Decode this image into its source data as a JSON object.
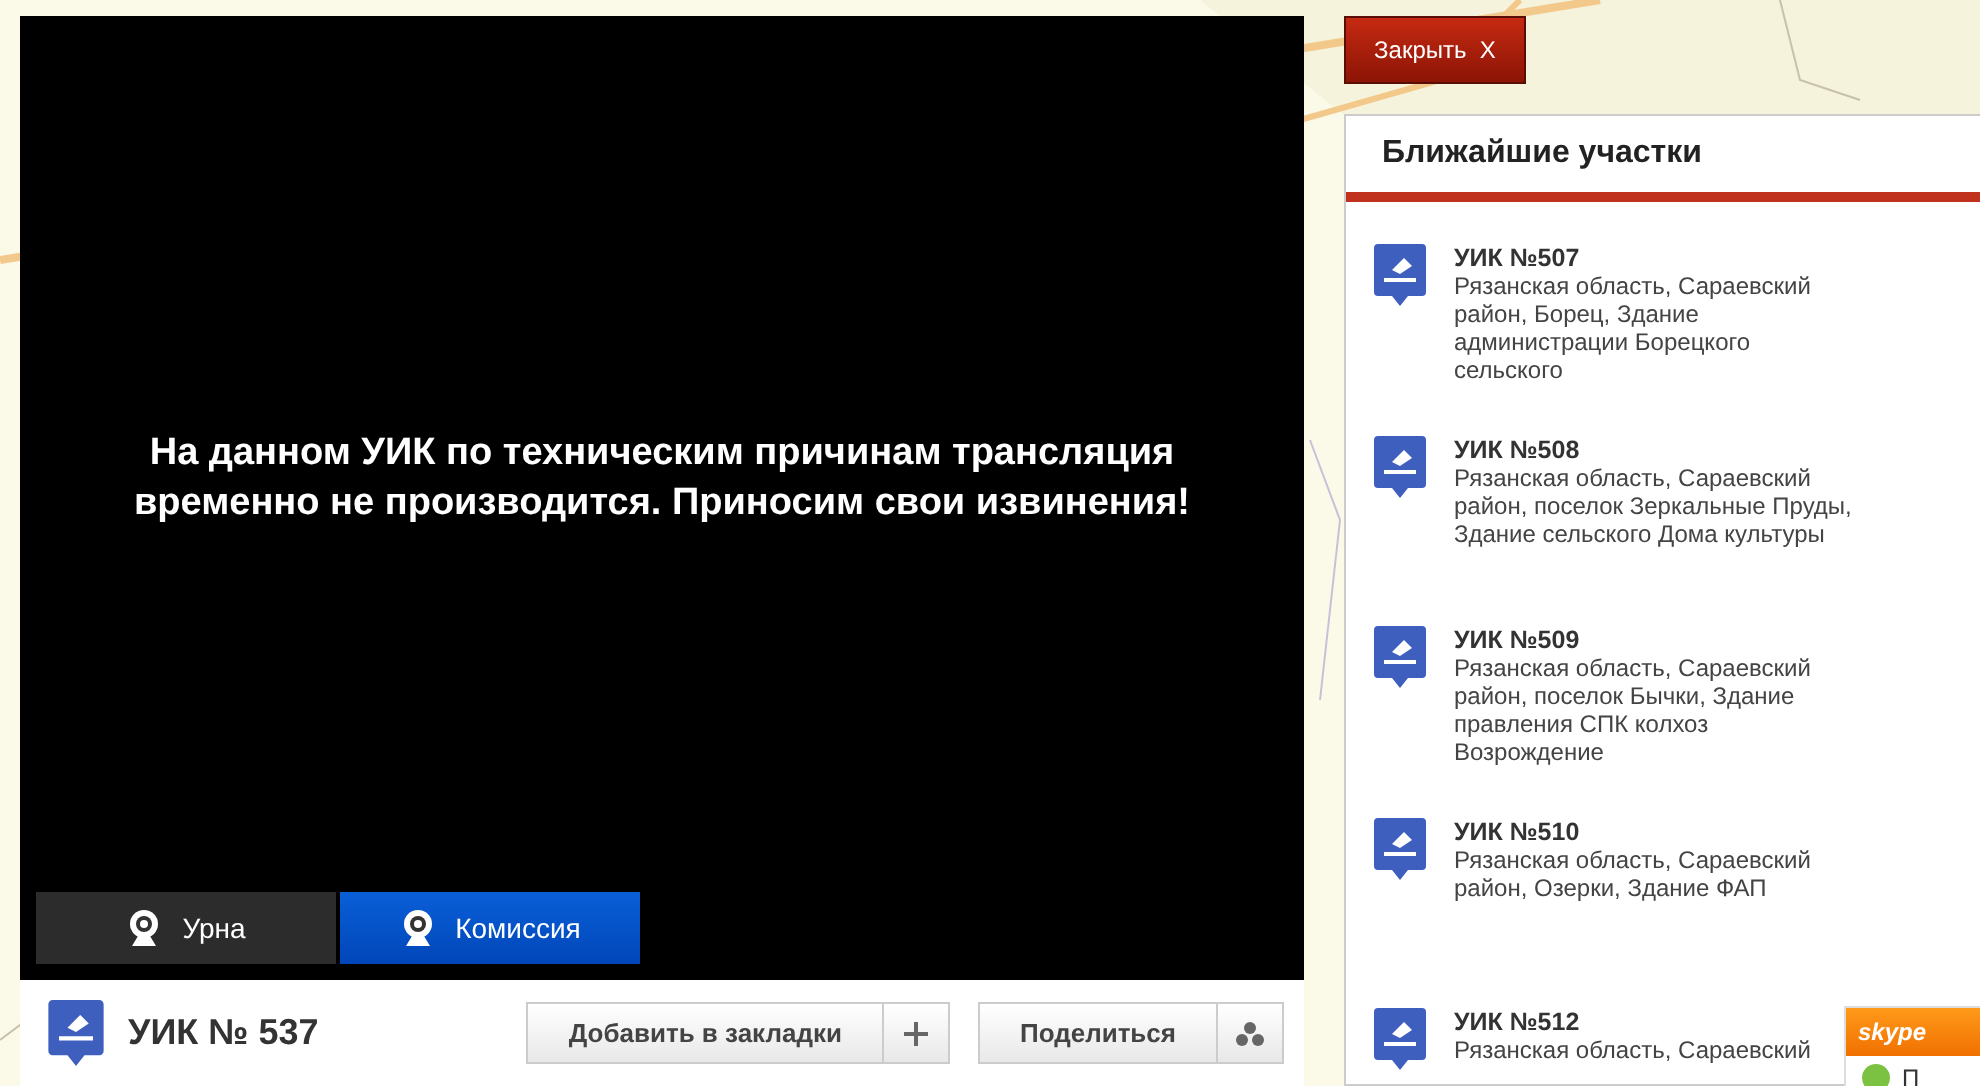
{
  "video": {
    "message": "На данном УИК по техническим причинам трансляция временно не производится. Приносим свои извинения!",
    "cameras": [
      {
        "label": "Урна",
        "selected": false
      },
      {
        "label": "Комиссия",
        "selected": true
      }
    ]
  },
  "station": {
    "title": "УИК № 537",
    "buttons": [
      {
        "label": "Добавить в закладки",
        "kind": "plus"
      },
      {
        "label": "Поделиться",
        "kind": "share"
      }
    ]
  },
  "close_button": "Закрыть  X",
  "nearby": {
    "title": "Ближайшие участки",
    "items": [
      {
        "name": "УИК №507",
        "address": "Рязанская область, Сараевский район, Борец, Здание администрации Борецкого сельского"
      },
      {
        "name": "УИК №508",
        "address": "Рязанская область, Сараевский район, поселок Зеркальные Пруды, Здание сельского Дома культуры"
      },
      {
        "name": "УИК №509",
        "address": "Рязанская область, Сараевский район, поселок Бычки, Здание правления СПК колхоз Возрождение"
      },
      {
        "name": "УИК №510",
        "address": "Рязанская область, Сараевский район, Озерки, Здание ФАП"
      },
      {
        "name": "УИК №512",
        "address": "Рязанская область, Сараевский"
      }
    ]
  },
  "skype_widget": {
    "logo": "skype",
    "label": "П"
  }
}
